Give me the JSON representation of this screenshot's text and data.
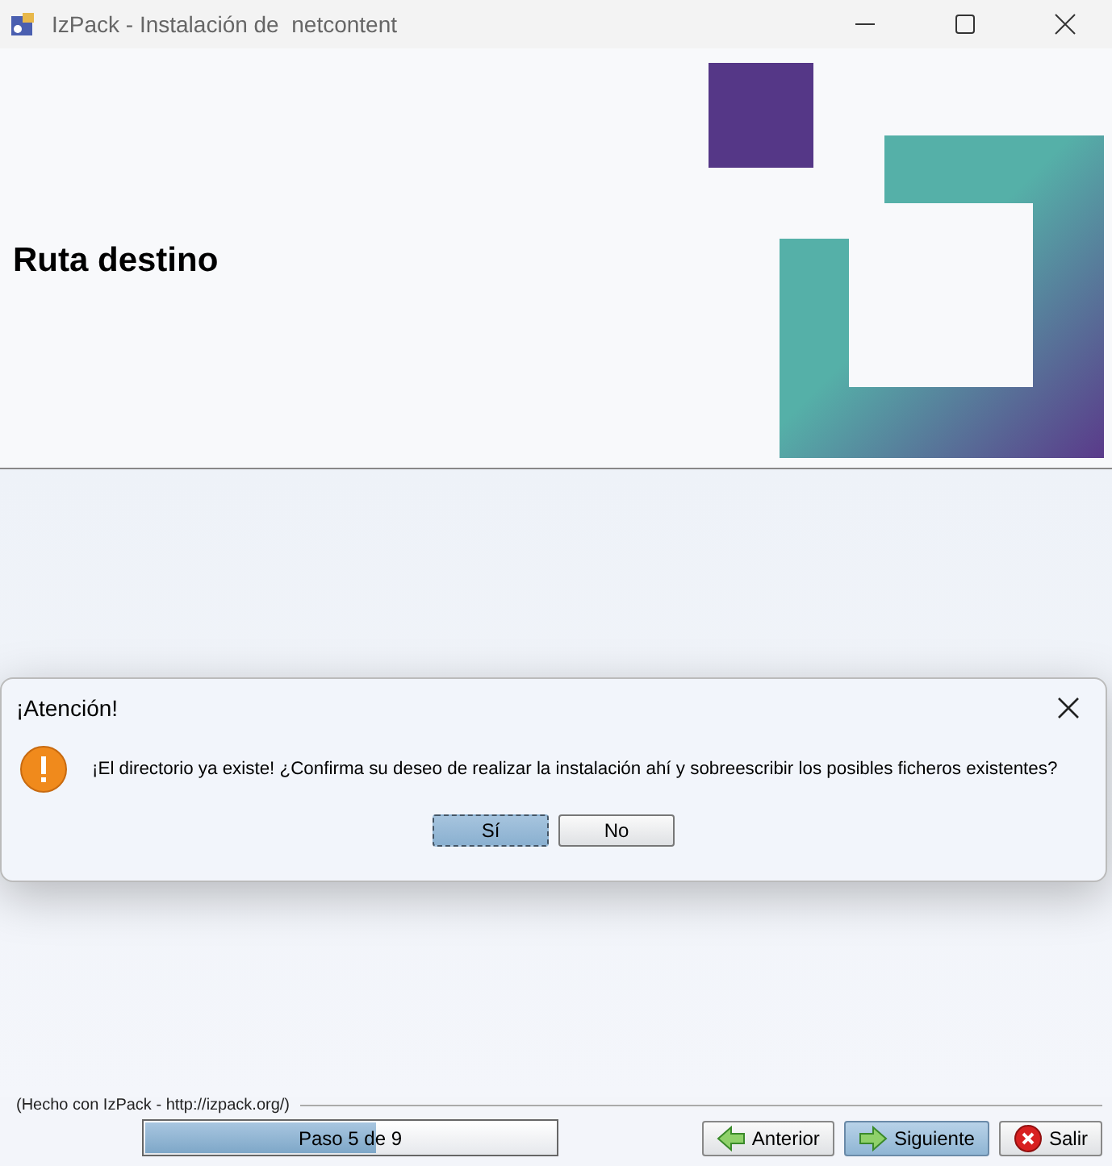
{
  "window": {
    "title": "IzPack - Instalación de  netcontent"
  },
  "header": {
    "title": "Ruta destino"
  },
  "dialog": {
    "title": "¡Atención!",
    "message": "¡El directorio ya existe! ¿Confirma su deseo de realizar la instalación ahí y sobreescribir los posibles ficheros existentes?",
    "buttons": [
      {
        "label": "Sí",
        "selected": true
      },
      {
        "label": "No",
        "selected": false
      }
    ]
  },
  "footer": {
    "credit": "(Hecho con IzPack - http://izpack.org/)",
    "progress": {
      "label": "Paso 5 de 9",
      "level": 0.56
    },
    "buttons": [
      {
        "label": "Anterior",
        "kind": "back",
        "selected": false
      },
      {
        "label": "Siguiente",
        "kind": "next",
        "selected": true
      },
      {
        "label": "Salir",
        "kind": "quit",
        "selected": false
      }
    ]
  }
}
